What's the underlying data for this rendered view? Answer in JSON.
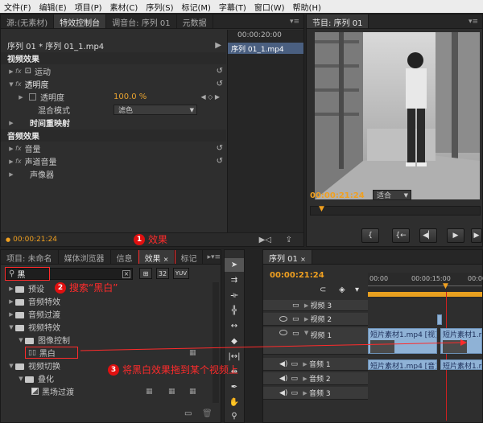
{
  "menubar": [
    "文件(F)",
    "编辑(E)",
    "项目(P)",
    "素材(C)",
    "序列(S)",
    "标记(M)",
    "字幕(T)",
    "窗口(W)",
    "帮助(H)"
  ],
  "effect_controls": {
    "tabs": [
      "源:(无素材)",
      "特效控制台",
      "调音台: 序列 01",
      "元数据"
    ],
    "sequence_path": "序列 01 * 序列 01_1.mp4",
    "video_effects_header": "视频效果",
    "motion": "运动",
    "opacity": "透明度",
    "opacity_param": "透明度",
    "opacity_value": "100.0 %",
    "blend_mode_label": "混合模式",
    "blend_mode_value": "滤色",
    "time_remap": "时间重映射",
    "audio_effects_header": "音频效果",
    "volume": "音量",
    "channel_volume": "声道音量",
    "panner": "声像器",
    "timecode": "00:00:21:24",
    "mini_timecode": "00:00:20:00",
    "mini_clip": "序列 01_1.mp4"
  },
  "program_monitor": {
    "tab": "节目: 序列 01",
    "timecode": "00:00:21:24",
    "fit": "适合"
  },
  "project_panel": {
    "tabs": [
      "项目: 未命名",
      "媒体浏览器",
      "信息",
      "效果",
      "标记"
    ],
    "search_value": "黑",
    "buttons": [
      "32",
      "YUV"
    ],
    "tree": [
      {
        "label": "预设",
        "level": 0,
        "expanded": false
      },
      {
        "label": "音频特效",
        "level": 0,
        "expanded": false
      },
      {
        "label": "音频过渡",
        "level": 0,
        "expanded": false
      },
      {
        "label": "视频特效",
        "level": 0,
        "expanded": true
      },
      {
        "label": "图像控制",
        "level": 1,
        "expanded": true
      },
      {
        "label": "黑白",
        "level": 2,
        "expanded": false,
        "item": true
      },
      {
        "label": "视频切换",
        "level": 0,
        "expanded": true
      },
      {
        "label": "叠化",
        "level": 1,
        "expanded": true
      },
      {
        "label": "黑场过渡",
        "level": 2,
        "expanded": false,
        "item": true
      }
    ]
  },
  "timeline": {
    "tab": "序列 01",
    "timecode": "00:00:21:24",
    "ruler": [
      "00:00",
      "00:00:15:00",
      "00:00"
    ],
    "tracks": [
      {
        "name": "视频 3"
      },
      {
        "name": "视频 2"
      },
      {
        "name": "视频 1"
      },
      {
        "name": "音频 1"
      },
      {
        "name": "音频 2"
      },
      {
        "name": "音频 3"
      }
    ],
    "clips": {
      "v1_a": "短片素材1.mp4 [视]",
      "v1_b": "短片素材1.mp4",
      "a1_a": "短片素材1.mp4 [音]",
      "a1_b": "短片素材1.mp4"
    }
  },
  "annotations": {
    "step1": "效果",
    "step2": "搜索“黑白”",
    "step3": "将黑白效果拖到某个视频上",
    "n1": "1",
    "n2": "2",
    "n3": "3"
  },
  "colors": {
    "accent": "#f0a020",
    "annotation": "#ff2b2b",
    "clip": "#8fb2d6"
  }
}
